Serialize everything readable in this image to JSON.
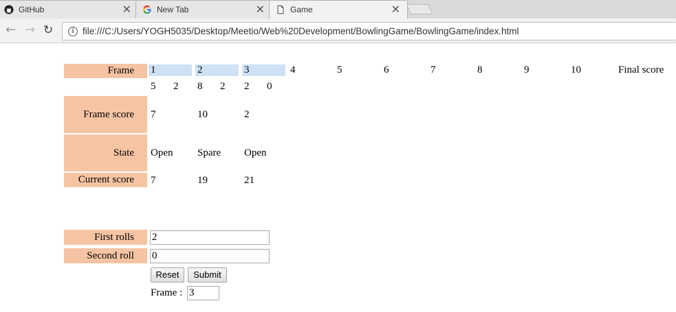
{
  "browser": {
    "tabs": [
      {
        "title": "GitHub",
        "favicon": "github-icon"
      },
      {
        "title": "New Tab",
        "favicon": "google-icon"
      },
      {
        "title": "Game",
        "favicon": "page-icon",
        "active": true
      }
    ],
    "close_glyph": "✕",
    "url": "file:///C:/Users/YOGH5035/Desktop/Meetio/Web%20Development/BowlingGame/BowlingGame/index.html"
  },
  "game": {
    "frame_label": "Frame",
    "frames": [
      "1",
      "2",
      "3",
      "4",
      "5",
      "6",
      "7",
      "8",
      "9",
      "10"
    ],
    "final_score_label": "Final score",
    "rolls": [
      [
        "5",
        "2"
      ],
      [
        "8",
        "2"
      ],
      [
        "2",
        "0"
      ]
    ],
    "frame_score_label": "Frame score",
    "frame_scores": [
      "7",
      "10",
      "2"
    ],
    "state_label": "State",
    "states": [
      "Open",
      "Spare",
      "Open"
    ],
    "current_score_label": "Current score",
    "current_scores": [
      "7",
      "19",
      "21"
    ]
  },
  "form": {
    "first_rolls_label": "First rolls",
    "first_rolls_value": "2",
    "second_roll_label": "Second roll",
    "second_roll_value": "0",
    "reset_label": "Reset",
    "submit_label": "Submit",
    "frame_counter_label": "Frame :",
    "frame_counter_value": "3"
  },
  "colors": {
    "label_background": "#f6c4a3",
    "frame_highlight": "#cfe2f5"
  }
}
